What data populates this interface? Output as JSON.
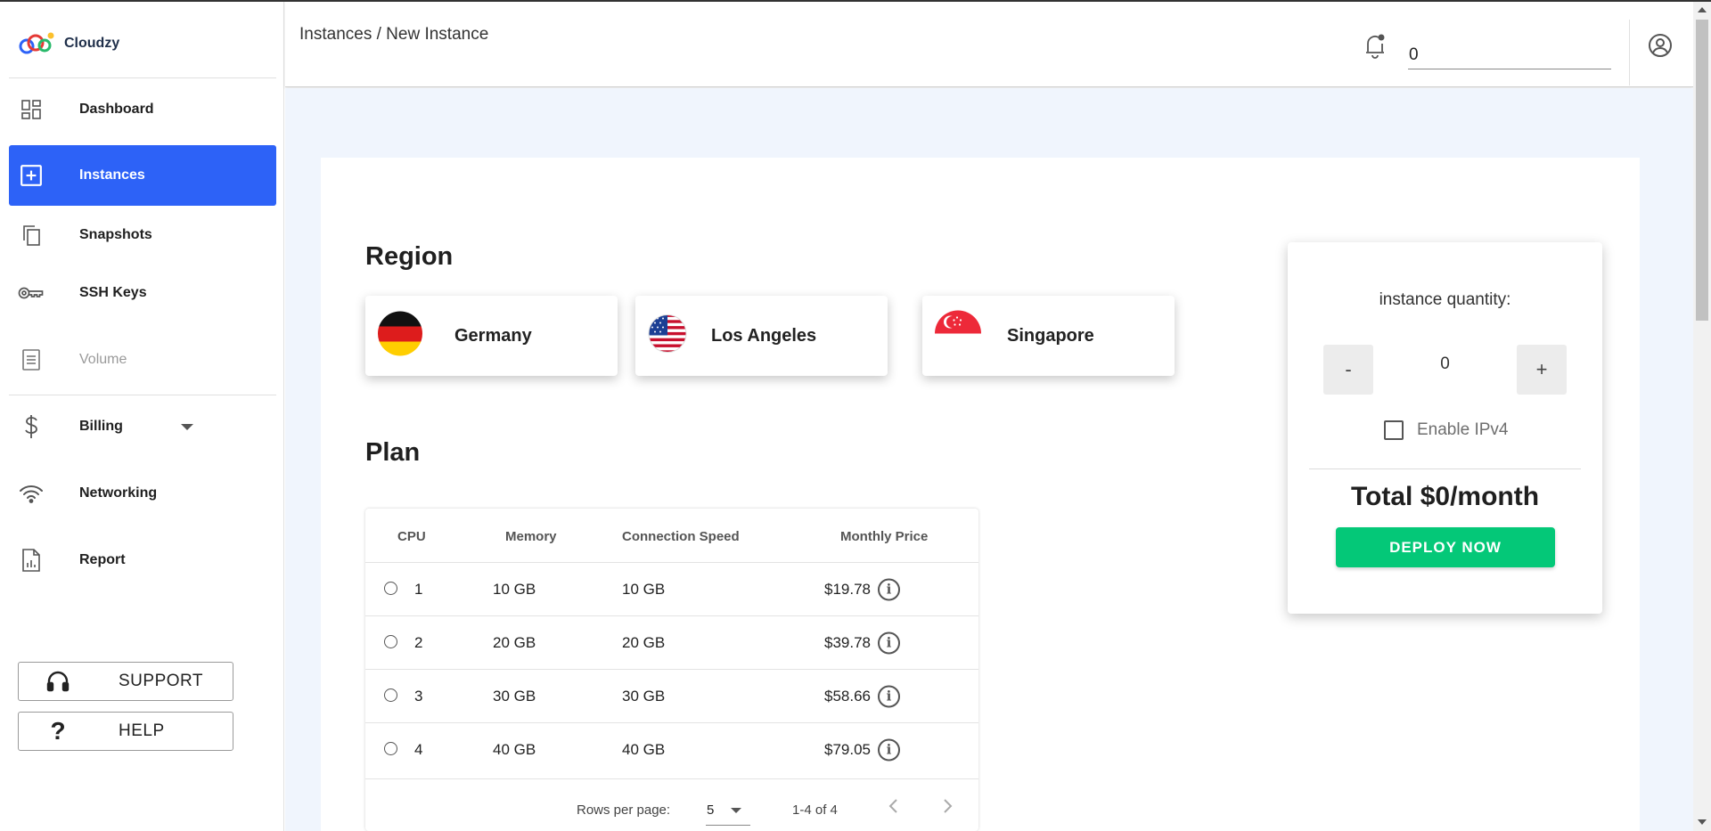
{
  "app": {
    "brand": "Cloudzy"
  },
  "header": {
    "breadcrumb": "Instances / New Instance",
    "credit_value": "0"
  },
  "sidebar": {
    "items": [
      {
        "label": "Dashboard",
        "icon": "dashboard-icon"
      },
      {
        "label": "Instances",
        "icon": "add-box-icon",
        "active": true
      },
      {
        "label": "Snapshots",
        "icon": "copy-icon"
      },
      {
        "label": "SSH Keys",
        "icon": "key-icon"
      },
      {
        "label": "Volume",
        "icon": "document-icon",
        "disabled": true
      },
      {
        "label": "Billing",
        "icon": "dollar-icon",
        "expandable": true
      },
      {
        "label": "Networking",
        "icon": "wifi-icon"
      },
      {
        "label": "Report",
        "icon": "report-icon"
      }
    ],
    "support_label": "SUPPORT",
    "help_label": "HELP"
  },
  "region": {
    "title": "Region",
    "options": [
      {
        "name": "Germany",
        "flag": "germany-flag-icon"
      },
      {
        "name": "Los Angeles",
        "flag": "usa-flag-icon"
      },
      {
        "name": "Singapore",
        "flag": "singapore-flag-icon"
      }
    ]
  },
  "plan": {
    "title": "Plan",
    "columns": [
      "CPU",
      "Memory",
      "Connection Speed",
      "Monthly Price"
    ],
    "rows": [
      {
        "cpu": "1",
        "memory": "10 GB",
        "speed": "10 GB",
        "price": "$19.78"
      },
      {
        "cpu": "2",
        "memory": "20 GB",
        "speed": "20 GB",
        "price": "$39.78"
      },
      {
        "cpu": "3",
        "memory": "30 GB",
        "speed": "30 GB",
        "price": "$58.66"
      },
      {
        "cpu": "4",
        "memory": "40 GB",
        "speed": "40 GB",
        "price": "$79.05"
      }
    ],
    "pagination": {
      "rows_per_page_label": "Rows per page:",
      "rows_per_page_value": "5",
      "range": "1-4 of 4"
    }
  },
  "summary": {
    "quantity_label": "instance quantity:",
    "decrement_label": "-",
    "increment_label": "+",
    "quantity_value": "0",
    "ipv4_label": "Enable IPv4",
    "ipv4_checked": false,
    "total": "Total $0/month",
    "deploy_label": "DEPLOY NOW"
  },
  "colors": {
    "accent": "#2d62f7",
    "deploy": "#04c878",
    "main_bg": "#f0f5fd"
  }
}
